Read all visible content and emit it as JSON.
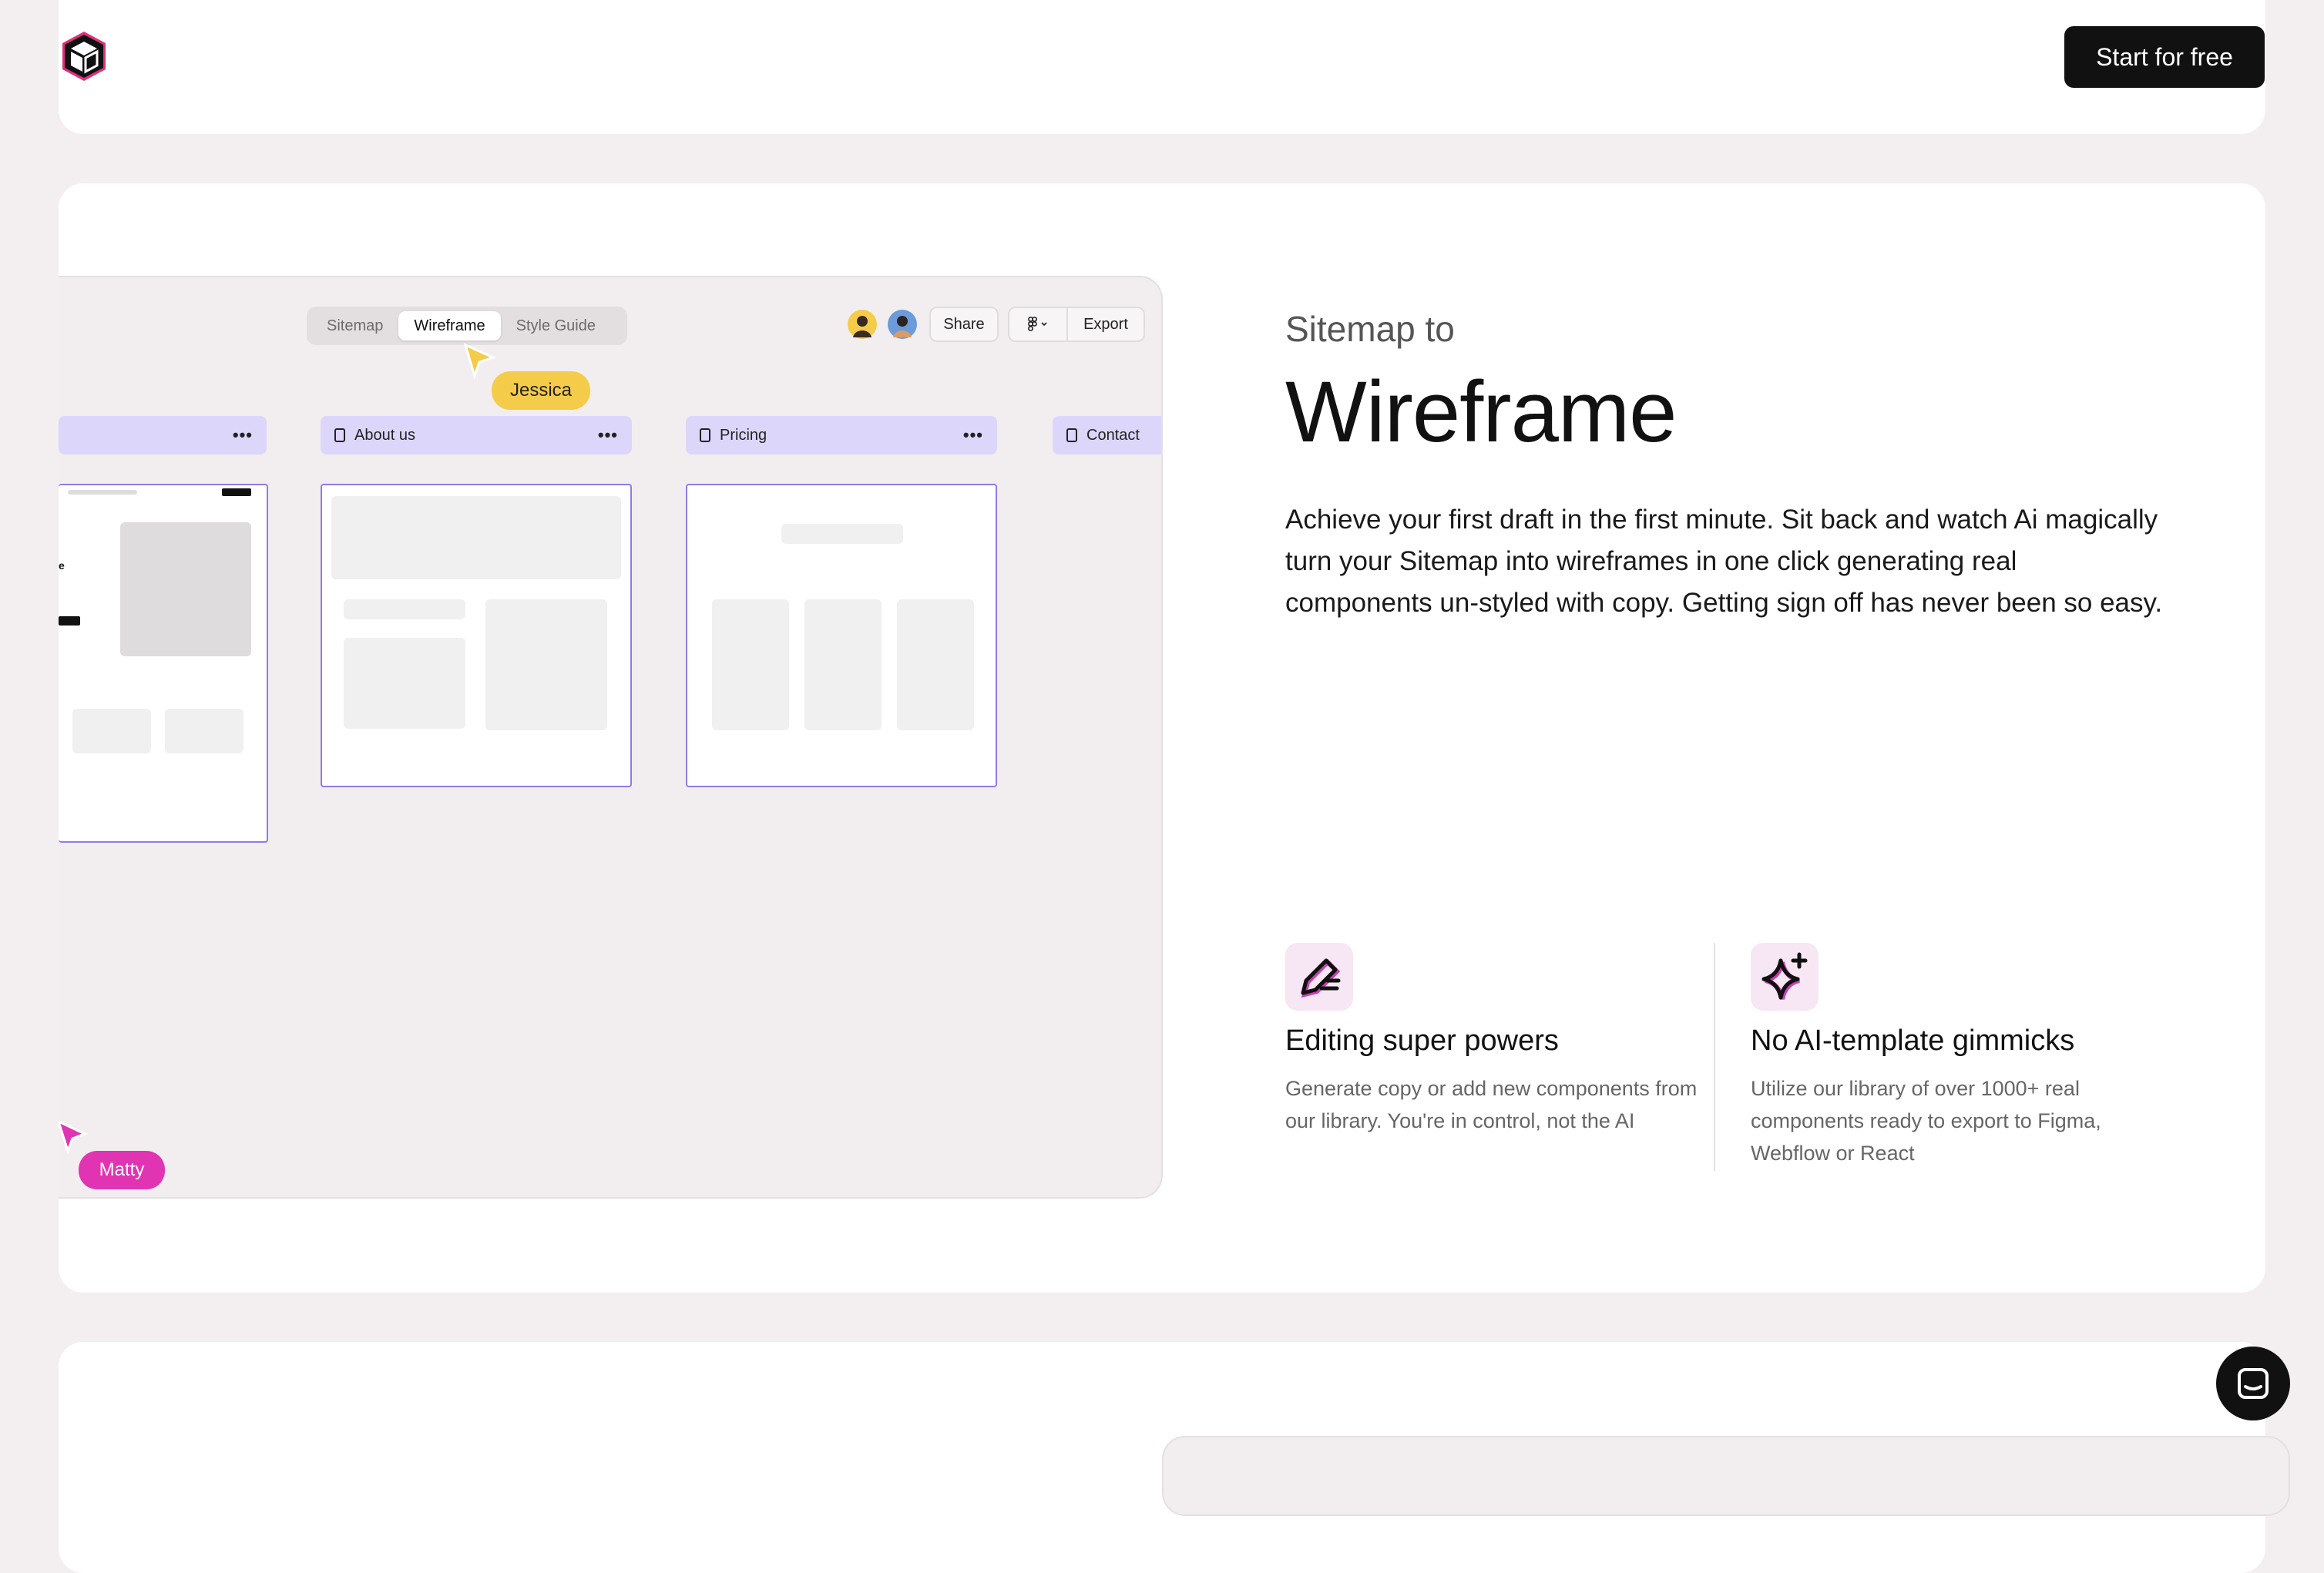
{
  "header": {
    "cta_label": "Start for free"
  },
  "mockup": {
    "tabs": [
      "Sitemap",
      "Wireframe",
      "Style Guide"
    ],
    "share_label": "Share",
    "export_label": "Export",
    "cursors": [
      {
        "name": "Jessica",
        "color": "#f5cc4a"
      },
      {
        "name": "Matty",
        "color": "#e134b3"
      }
    ],
    "pages": [
      "About us",
      "Pricing",
      "Contact"
    ],
    "more_glyph": "•••"
  },
  "section": {
    "eyebrow": "Sitemap to",
    "title": "Wireframe",
    "body": "Achieve your first draft in the first minute. Sit back and watch Ai magically turn your Sitemap into wireframes in one click generating real components un-styled with copy. Getting sign off has never been so easy.",
    "features": [
      {
        "icon": "pencil-edit-icon",
        "title": "Editing super powers",
        "desc": "Generate copy or add new components from our library. You're in control, not the AI"
      },
      {
        "icon": "sparkle-icon",
        "title": "No AI-template gimmicks",
        "desc": "Utilize our library of over 1000+ real components ready to export to Figma, Webflow or React"
      }
    ]
  },
  "colors": {
    "accent_purple": "#ddd6fb",
    "frame_border": "#8f7be8",
    "dark": "#111111"
  }
}
